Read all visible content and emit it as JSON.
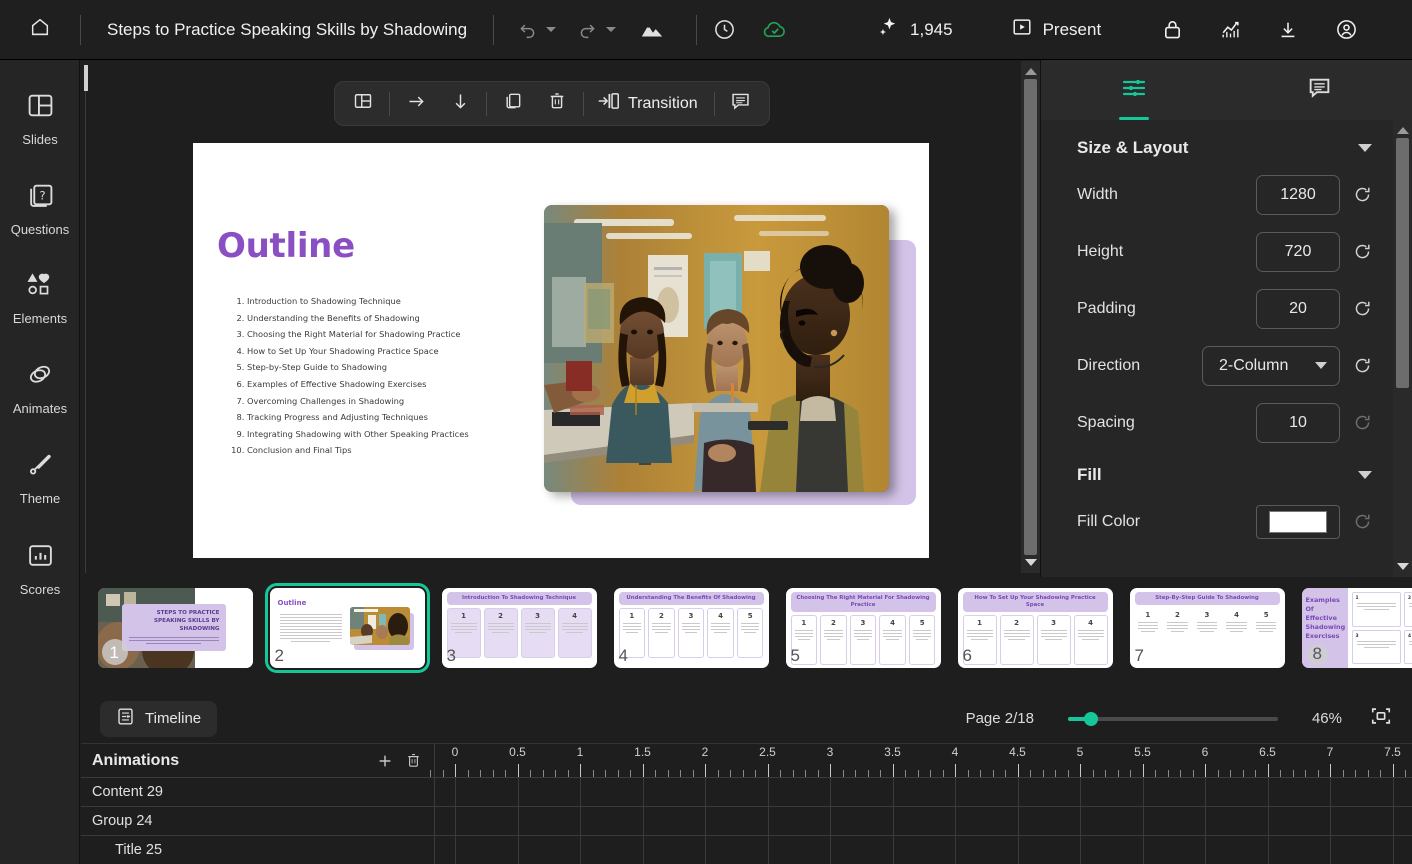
{
  "topbar": {
    "home_icon": "home-icon",
    "doc_title": "Steps to Practice Speaking Skills by Shadowing",
    "undo_icon": "undo-icon",
    "redo_icon": "redo-icon",
    "mountain_icon": "image-insert-icon",
    "history_icon": "version-history-icon",
    "saved_icon": "cloud-saved-icon",
    "ai_icon": "sparkle-icon",
    "ai_credits": "1,945",
    "present_icon": "present-play-icon",
    "present_label": "Present",
    "lock_icon": "lock-icon",
    "analytics_icon": "analytics-icon",
    "download_icon": "download-icon",
    "account_icon": "account-avatar-icon"
  },
  "sidebar": {
    "items": [
      {
        "label": "Slides",
        "icon": "slides-icon"
      },
      {
        "label": "Questions",
        "icon": "questions-icon"
      },
      {
        "label": "Elements",
        "icon": "elements-icon"
      },
      {
        "label": "Animates",
        "icon": "animates-icon"
      },
      {
        "label": "Theme",
        "icon": "theme-brush-icon"
      },
      {
        "label": "Scores",
        "icon": "scores-chart-icon"
      }
    ]
  },
  "float_toolbar": {
    "layout_icon": "layout-icon",
    "arrow_right_icon": "arrow-right-icon",
    "arrow_down_icon": "arrow-down-icon",
    "duplicate_icon": "duplicate-icon",
    "delete_icon": "trash-icon",
    "transition_icon": "transition-icon",
    "transition_label": "Transition",
    "comment_icon": "comment-icon"
  },
  "slide": {
    "title": "Outline",
    "items": [
      "Introduction to Shadowing Technique",
      "Understanding the Benefits of Shadowing",
      "Choosing the Right Material for Shadowing Practice",
      "How to Set Up Your Shadowing Practice Space",
      "Step-by-Step Guide to Shadowing",
      "Examples of Effective Shadowing Exercises",
      "Overcoming Challenges in Shadowing",
      "Tracking Progress and Adjusting Techniques",
      "Integrating Shadowing with Other Speaking Practices",
      "Conclusion and Final Tips"
    ],
    "image_alt": "classroom-photo-students-listening",
    "accent_color": "#D3C3E8",
    "title_color": "#8B4FC4"
  },
  "right_panel": {
    "tabs": [
      {
        "name": "properties",
        "icon": "sliders-icon",
        "active": true
      },
      {
        "name": "notes",
        "icon": "notes-comment-icon",
        "active": false
      }
    ],
    "accent_color": "#16C79A",
    "sections": [
      {
        "title": "Size & Layout",
        "rows": [
          {
            "label": "Width",
            "value": "1280",
            "type": "input"
          },
          {
            "label": "Height",
            "value": "720",
            "type": "input"
          },
          {
            "label": "Padding",
            "value": "20",
            "type": "input"
          },
          {
            "label": "Direction",
            "value": "2-Column",
            "type": "select"
          },
          {
            "label": "Spacing",
            "value": "10",
            "type": "input"
          }
        ]
      },
      {
        "title": "Fill",
        "rows": [
          {
            "label": "Fill Color",
            "value": "#FFFFFF",
            "type": "color"
          }
        ]
      }
    ]
  },
  "thumbnails": [
    {
      "num": "1",
      "title": "STEPS TO PRACTICE SPEAKING SKILLS BY SHADOWING",
      "kind": "cover",
      "selected": false
    },
    {
      "num": "2",
      "title": "Outline",
      "kind": "outline",
      "selected": true
    },
    {
      "num": "3",
      "title": "Introduction To Shadowing Technique",
      "kind": "columns",
      "columns": 4,
      "selected": false
    },
    {
      "num": "4",
      "title": "Understanding The Benefits Of Shadowing",
      "kind": "columns",
      "columns": 5,
      "selected": false
    },
    {
      "num": "5",
      "title": "Choosing The Right Material For Shadowing Practice",
      "kind": "columns",
      "columns": 5,
      "selected": false
    },
    {
      "num": "6",
      "title": "How To Set Up Your Shadowing Practice Space",
      "kind": "columns",
      "columns": 4,
      "selected": false
    },
    {
      "num": "7",
      "title": "Step-By-Step Guide To Shadowing",
      "kind": "columns",
      "columns": 5,
      "selected": false
    },
    {
      "num": "8",
      "title": "Examples Of Effective Shadowing Exercises",
      "kind": "grid",
      "selected": false
    }
  ],
  "pagebar": {
    "timeline_icon": "timeline-icon",
    "timeline_label": "Timeline",
    "page_label": "Page 2/18",
    "zoom_pct": "46%",
    "fit_icon": "fit-to-screen-icon"
  },
  "animations": {
    "title": "Animations",
    "add_icon": "plus-icon",
    "delete_icon": "trash-icon",
    "rows": [
      {
        "label": "Content 29",
        "indent": false
      },
      {
        "label": "Group 24",
        "indent": false
      },
      {
        "label": "Title 25",
        "indent": true
      }
    ],
    "ruler_labels": [
      "0",
      "0.5",
      "1",
      "1.5",
      "2",
      "2.5",
      "3",
      "3.5",
      "4",
      "4.5",
      "5",
      "5.5",
      "6",
      "6.5",
      "7",
      "7.5"
    ]
  }
}
